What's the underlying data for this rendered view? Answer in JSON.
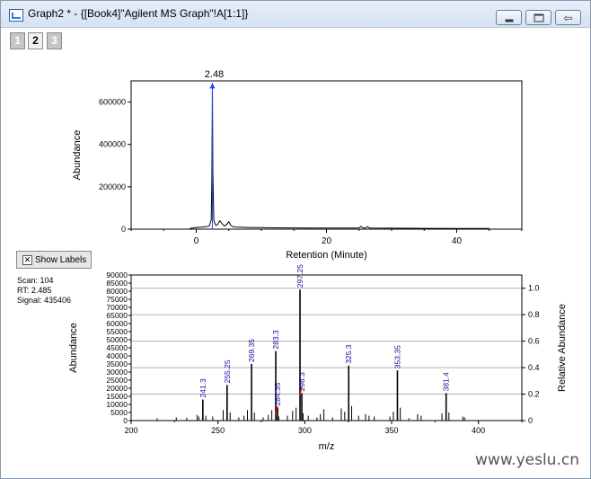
{
  "window": {
    "title": "Graph2 * - {[Book4]\"Agilent MS Graph\"!A[1:1]}",
    "buttons": {
      "minimize": "minimize",
      "maximize": "maximize",
      "restore": "restore"
    }
  },
  "layers": [
    {
      "label": "1",
      "active": false
    },
    {
      "label": "2",
      "active": true
    },
    {
      "label": "3",
      "active": false
    }
  ],
  "show_labels": {
    "label": "Show Labels"
  },
  "scan_info": {
    "scan": "Scan: 104",
    "rt": "RT: 2.485",
    "signal": "Signal: 435406"
  },
  "watermark": "www.yeslu.cn",
  "colors": {
    "peak_label": "#1010a0",
    "marker": "#2040ff",
    "highlight": "#ff0000",
    "line": "#000000"
  },
  "chart_data": [
    {
      "type": "line",
      "title": "",
      "xlabel": "Retention (Minute)",
      "ylabel": "Abundance",
      "xlim": [
        -10,
        50
      ],
      "ylim": [
        0,
        700000
      ],
      "xticks": [
        0,
        20,
        40
      ],
      "yticks": [
        0,
        200000,
        400000,
        600000
      ],
      "peak_label": "2.48",
      "peak_x": 2.48,
      "series": [
        {
          "x": [
            -1,
            0,
            1,
            1.5,
            2,
            2.3,
            2.4,
            2.48,
            2.55,
            2.7,
            3,
            3.3,
            3.6,
            4,
            4.3,
            4.6,
            5,
            5.3,
            5.6,
            6,
            7,
            8,
            10,
            12,
            15,
            18,
            20,
            22,
            24,
            25,
            25.3,
            25.6,
            26,
            26.3,
            26.6,
            27,
            30,
            35,
            40,
            45
          ],
          "y": [
            3000,
            8000,
            10000,
            12000,
            15000,
            45000,
            250000,
            690000,
            260000,
            40000,
            18000,
            22000,
            40000,
            25000,
            15000,
            20000,
            35000,
            18000,
            12000,
            10000,
            9000,
            8000,
            7000,
            6500,
            6000,
            5500,
            5000,
            5000,
            5500,
            6000,
            13000,
            6000,
            5500,
            12000,
            5500,
            5000,
            4500,
            4000,
            3500,
            3000
          ]
        }
      ]
    },
    {
      "type": "bar",
      "title": "",
      "xlabel": "m/z",
      "ylabel": "Abundance",
      "y2label": "Relative Abundance",
      "xlim": [
        200,
        425
      ],
      "ylim": [
        0,
        90000
      ],
      "y2lim": [
        0,
        1.1
      ],
      "xticks": [
        200,
        250,
        300,
        350,
        400
      ],
      "yticks": [
        0,
        5000,
        10000,
        15000,
        20000,
        25000,
        30000,
        35000,
        40000,
        45000,
        50000,
        55000,
        60000,
        65000,
        70000,
        75000,
        80000,
        85000,
        90000
      ],
      "y2ticks": [
        0,
        0.2,
        0.4,
        0.6,
        0.8,
        1.0
      ],
      "gridlines_y2": [
        0.2,
        0.4,
        0.6,
        0.8,
        1.0
      ],
      "peaks": [
        {
          "mz": 241.3,
          "value": 13000,
          "label": "241.3"
        },
        {
          "mz": 255.25,
          "value": 22000,
          "label": "255.25"
        },
        {
          "mz": 269.35,
          "value": 35000,
          "label": "269.35"
        },
        {
          "mz": 283.3,
          "value": 43000,
          "label": "283.3"
        },
        {
          "mz": 284.35,
          "value": 8000,
          "label": "284.35"
        },
        {
          "mz": 297.25,
          "value": 81000,
          "label": "297.25"
        },
        {
          "mz": 298.3,
          "value": 17000,
          "label": "298.3"
        },
        {
          "mz": 325.3,
          "value": 34000,
          "label": "325.3"
        },
        {
          "mz": 353.35,
          "value": 31000,
          "label": "353.35"
        },
        {
          "mz": 381.4,
          "value": 17000,
          "label": "381.4"
        }
      ],
      "minor_peaks": [
        {
          "mz": 215,
          "value": 1500
        },
        {
          "mz": 226,
          "value": 2000
        },
        {
          "mz": 232,
          "value": 1800
        },
        {
          "mz": 238,
          "value": 3500
        },
        {
          "mz": 239,
          "value": 2500
        },
        {
          "mz": 243,
          "value": 3000
        },
        {
          "mz": 247,
          "value": 2500
        },
        {
          "mz": 253,
          "value": 6500
        },
        {
          "mz": 257,
          "value": 5000
        },
        {
          "mz": 262,
          "value": 2000
        },
        {
          "mz": 265,
          "value": 3000
        },
        {
          "mz": 267,
          "value": 6500
        },
        {
          "mz": 271,
          "value": 5000
        },
        {
          "mz": 276,
          "value": 2000
        },
        {
          "mz": 279,
          "value": 3500
        },
        {
          "mz": 281,
          "value": 6500
        },
        {
          "mz": 285,
          "value": 2500
        },
        {
          "mz": 290,
          "value": 3000
        },
        {
          "mz": 293,
          "value": 6000
        },
        {
          "mz": 295,
          "value": 8000
        },
        {
          "mz": 299,
          "value": 4500
        },
        {
          "mz": 302,
          "value": 3000
        },
        {
          "mz": 307,
          "value": 2000
        },
        {
          "mz": 309,
          "value": 4000
        },
        {
          "mz": 311,
          "value": 7000
        },
        {
          "mz": 316,
          "value": 2000
        },
        {
          "mz": 321,
          "value": 7500
        },
        {
          "mz": 323,
          "value": 5500
        },
        {
          "mz": 327,
          "value": 9000
        },
        {
          "mz": 331,
          "value": 3000
        },
        {
          "mz": 335,
          "value": 4000
        },
        {
          "mz": 337,
          "value": 3000
        },
        {
          "mz": 340,
          "value": 2500
        },
        {
          "mz": 349,
          "value": 2500
        },
        {
          "mz": 351,
          "value": 5500
        },
        {
          "mz": 355,
          "value": 8000
        },
        {
          "mz": 360,
          "value": 1500
        },
        {
          "mz": 365,
          "value": 4000
        },
        {
          "mz": 367,
          "value": 3000
        },
        {
          "mz": 379,
          "value": 4500
        },
        {
          "mz": 383,
          "value": 5000
        },
        {
          "mz": 391,
          "value": 2500
        },
        {
          "mz": 392,
          "value": 2000
        }
      ],
      "highlight_lines": [
        {
          "x": [
            283.3,
            284.35
          ],
          "y": [
            4000,
            9000
          ]
        },
        {
          "x": [
            297.25,
            298.3
          ],
          "y": [
            16000,
            21000
          ]
        }
      ]
    }
  ]
}
